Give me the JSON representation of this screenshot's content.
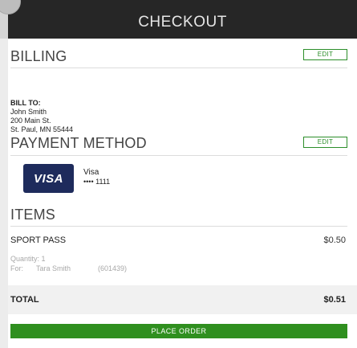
{
  "header": {
    "title": "CHECKOUT"
  },
  "billing": {
    "title": "BILLING",
    "edit_label": "EDIT",
    "bill_to_label": "BILL TO:",
    "name": "John Smith",
    "street": "200 Main St.",
    "city_line": "St. Paul, MN 55444"
  },
  "payment": {
    "title": "PAYMENT METHOD",
    "edit_label": "EDIT",
    "card_logo_text": "VISA",
    "card_brand": "Visa",
    "card_last4": "•••• 1111"
  },
  "items": {
    "title": "ITEMS",
    "list": [
      {
        "name": "SPORT PASS",
        "price": "$0.50",
        "quantity_text": "Quantity: 1",
        "for_label": "For:",
        "for_name": "Tara Smith",
        "for_id": "(601439)"
      }
    ]
  },
  "total": {
    "label": "TOTAL",
    "value": "$0.51"
  },
  "actions": {
    "place_order_label": "PLACE ORDER"
  },
  "colors": {
    "header_bg": "#262626",
    "accent_green": "#2f8f1f",
    "visa_blue": "#1e2b5c"
  }
}
